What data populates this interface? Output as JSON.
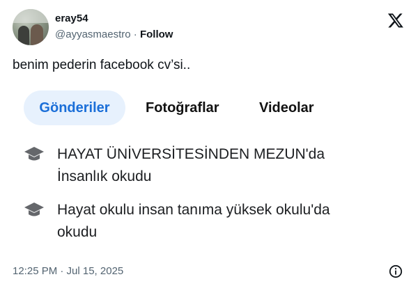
{
  "author": {
    "display_name": "eray54",
    "handle": "@ayyasmaestro",
    "separator": " · ",
    "follow_label": "Follow"
  },
  "tweet": {
    "text": "benim pederin facebook cv’si.."
  },
  "embed": {
    "tabs": [
      {
        "label": "Gönderiler",
        "active": true
      },
      {
        "label": "Fotoğraflar",
        "active": false
      },
      {
        "label": "Videolar",
        "active": false
      }
    ],
    "education": [
      {
        "icon": "graduation-cap-icon",
        "line1": "HAYAT ÜNİVERSİTESİNDEN MEZUN'da",
        "line2": "İnsanlık okudu"
      },
      {
        "icon": "graduation-cap-icon",
        "line1": "Hayat okulu insan tanıma yüksek okulu'da",
        "line2": "okudu"
      }
    ]
  },
  "footer": {
    "timestamp": "12:25 PM · Jul 15, 2025",
    "info_icon": "info-icon"
  },
  "colors": {
    "accent": "#1a6ed8",
    "active_tab_bg": "#e7f1fd",
    "secondary_text": "#536471"
  }
}
